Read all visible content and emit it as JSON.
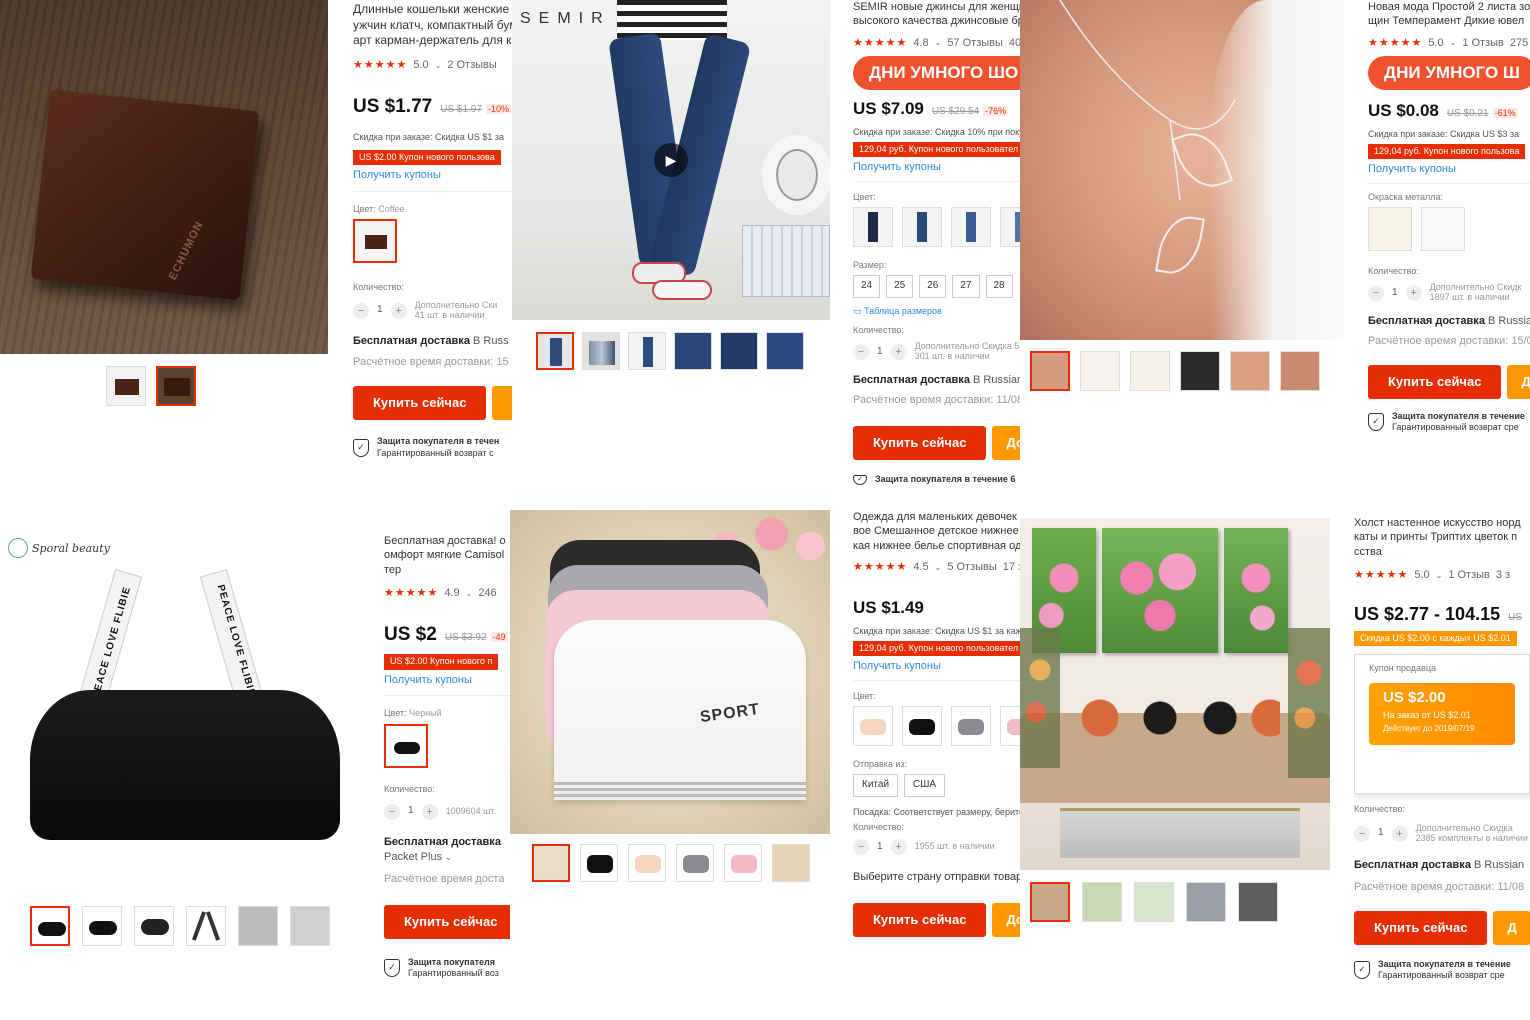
{
  "p1": {
    "title": "Длинные кошельки женские о\nужчин клатч, компактный бум\nарт карман-держатель для ка",
    "rating": "5.0",
    "reviews": "2 Отзывы",
    "price": "US $1.77",
    "old_price": "US $1.97",
    "discount": "-10%",
    "order_discount": "Скидка при заказе: Скидка US $1 за",
    "new_user_coupon": "US $2.00 Купон нового пользова",
    "get_coupons": "Получить купоны",
    "color_label": "Цвет:",
    "color_value": "Coffee",
    "quantity_label": "Количество:",
    "quantity": "1",
    "extra_note": "Дополнительно Ски",
    "stock": "41 шт. в наличии",
    "shipping": "Бесплатная доставка",
    "shipping_to": "В Russ",
    "delivery": "Расчётное время доставки: 15",
    "buy": "Купить сейчас",
    "protection": "Защита покупателя в течен",
    "protection_sub": "Гарантированный возврат с",
    "logo": "ECHUMON"
  },
  "p2": {
    "brand": "SEMIR"
  },
  "p3": {
    "title": "SEMIR новые джинсы для женщин\nвысокого качества джинсовые брю",
    "rating": "4.8",
    "reviews": "57 Отзывы",
    "reviews_more": "40",
    "promo": "ДНИ УМНОГО ШО",
    "price": "US $7.09",
    "old_price": "US $29.54",
    "discount": "-76%",
    "order_discount": "Скидка при заказе: Скидка 10% при поку",
    "new_user_coupon": "129,04 руб. Купон нового пользовател",
    "get_coupons": "Получить купоны",
    "color_label": "Цвет:",
    "size_label": "Размер:",
    "sizes": [
      "24",
      "25",
      "26",
      "27",
      "28"
    ],
    "size_table": "Таблица размеров",
    "quantity_label": "Количество:",
    "quantity": "1",
    "extra_note": "Дополнительно Скидка 5",
    "stock": "301 шт. в наличии",
    "shipping": "Бесплатная доставка",
    "shipping_to": "В Russian F",
    "delivery": "Расчётное время доставки: 11/08",
    "buy": "Купить сейчас",
    "add": "Доба",
    "protection": "Защита покупателя в течение 6"
  },
  "p4": {
    "title": "Новая мода Простой 2 листа зо\nщин Темперамент Дикие ювел",
    "rating": "5.0",
    "reviews": "1 Отзыв",
    "reviews_more": "275",
    "promo": "ДНИ УМНОГО Ш",
    "price": "US $0.08",
    "old_price": "US $0.21",
    "discount": "-61%",
    "order_discount": "Скидка при заказе: Скидка US $3 за",
    "new_user_coupon": "129,04 руб. Купон нового пользова",
    "get_coupons": "Получить купоны",
    "metal_label": "Окраска металла:",
    "quantity_label": "Количество:",
    "quantity": "1",
    "extra_note": "Дополнительно Скидк",
    "stock": "1897 шт. в наличии",
    "shipping": "Бесплатная доставка",
    "shipping_to": "В Russia",
    "delivery": "Расчётное время доставки: 15/0",
    "buy": "Купить сейчас",
    "add": "Д",
    "protection": "Защита покупателя в течение",
    "protection_sub": "Гарантированный возврат сре"
  },
  "p5": {
    "brand": "Sporal beauty",
    "title": "Бесплатная доставка! о\nомфорт мягкие Camisol\nтер",
    "rating": "4.9",
    "reviews_more": "246",
    "price": "US $2",
    "old_price": "US $3.92",
    "discount": "-49",
    "new_user_coupon": "US $2.00 Купон нового п",
    "get_coupons": "Получить купоны",
    "color_label": "Цвет:",
    "color_value": "Черный",
    "quantity_label": "Количество:",
    "quantity": "1",
    "stock": "1009604 шт.",
    "shipping": "Бесплатная доставка",
    "shipping_method": "Packet Plus",
    "delivery": "Расчётное время доста",
    "buy": "Купить сейчас",
    "protection": "Защита покупателя",
    "protection_sub": "Гарантированный воз",
    "strap_text": "PEACE LOVE FLIBIE"
  },
  "p6": {
    "sport": "SPORT"
  },
  "p7": {
    "title": "Одежда для маленьких девочек о\nвое Смешанное детское нижнее б\nкая нижнее белье спортивная оде",
    "rating": "4.5",
    "reviews": "5 Отзывы",
    "reviews_more": "17 з",
    "price": "US $1.49",
    "order_discount": "Скидка при заказе: Скидка US $1 за каж",
    "new_user_coupon": "129,04 руб. Купон нового пользовател",
    "get_coupons": "Получить купоны",
    "color_label": "Цвет:",
    "ship_from_label": "Отправка из:",
    "ship_from": [
      "Китай",
      "США"
    ],
    "fit": "Посадка: Соответствует размеру, берите",
    "quantity_label": "Количество:",
    "quantity": "1",
    "stock": "1955 шт. в наличии",
    "choose_country": "Выберите страну отправки товара",
    "buy": "Купить сейчас",
    "add": "Доб"
  },
  "p8": {
    "title": "Холст настенное искусство норд\nкаты и принты Триптих цветок п\nсства",
    "rating": "5.0",
    "reviews": "1 Отзыв",
    "reviews_more": "3 з",
    "price": "US $2.77 - 104.15",
    "price_more": "US",
    "discount_bar": "Скидка US $2.00 с каждых US $2.01",
    "seller_coupon": "Купон продавца",
    "coupon_amount": "US $2.00",
    "coupon_min": "На заказ от  US $2.01",
    "coupon_valid": "Действует до 2019/07/19",
    "quantity_label": "Количество:",
    "quantity": "1",
    "extra_note": "Дополнительно Скидка",
    "stock": "2385 комплекты в наличии",
    "shipping": "Бесплатная доставка",
    "shipping_to": "В Russian",
    "delivery": "Расчётное время доставки: 11/08",
    "buy": "Купить сейчас",
    "add": "Д",
    "protection": "Защита покупателя в течение",
    "protection_sub": "Гарантированный возврат сре"
  },
  "colors": {
    "accent": "#e62e04",
    "add_cart": "#ff9800",
    "link": "#2e8adf",
    "promo": "#f0512e"
  }
}
